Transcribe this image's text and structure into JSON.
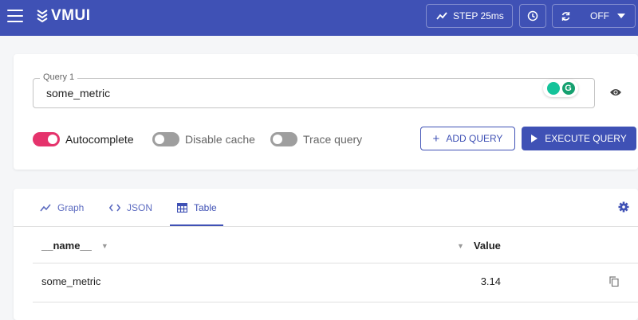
{
  "header": {
    "logo": "VMUI",
    "step_label": "STEP 25ms",
    "refresh_label": "OFF"
  },
  "query": {
    "label": "Query 1",
    "value": "some_metric",
    "toggles": [
      {
        "label": "Autocomplete",
        "on": true
      },
      {
        "label": "Disable cache",
        "on": false
      },
      {
        "label": "Trace query",
        "on": false
      }
    ],
    "add_label": "ADD QUERY",
    "execute_label": "EXECUTE QUERY"
  },
  "results": {
    "tabs": [
      {
        "label": "Graph",
        "icon": "graph-icon"
      },
      {
        "label": "JSON",
        "icon": "code-icon"
      },
      {
        "label": "Table",
        "icon": "table-icon",
        "active": true
      }
    ],
    "columns": [
      "__name__",
      "Value"
    ],
    "rows": [
      {
        "name": "some_metric",
        "value": "3.14"
      }
    ]
  },
  "colors": {
    "primary": "#3f51b5",
    "toggle_on": "#e5336c",
    "toggle_off": "#9e9e9e"
  }
}
